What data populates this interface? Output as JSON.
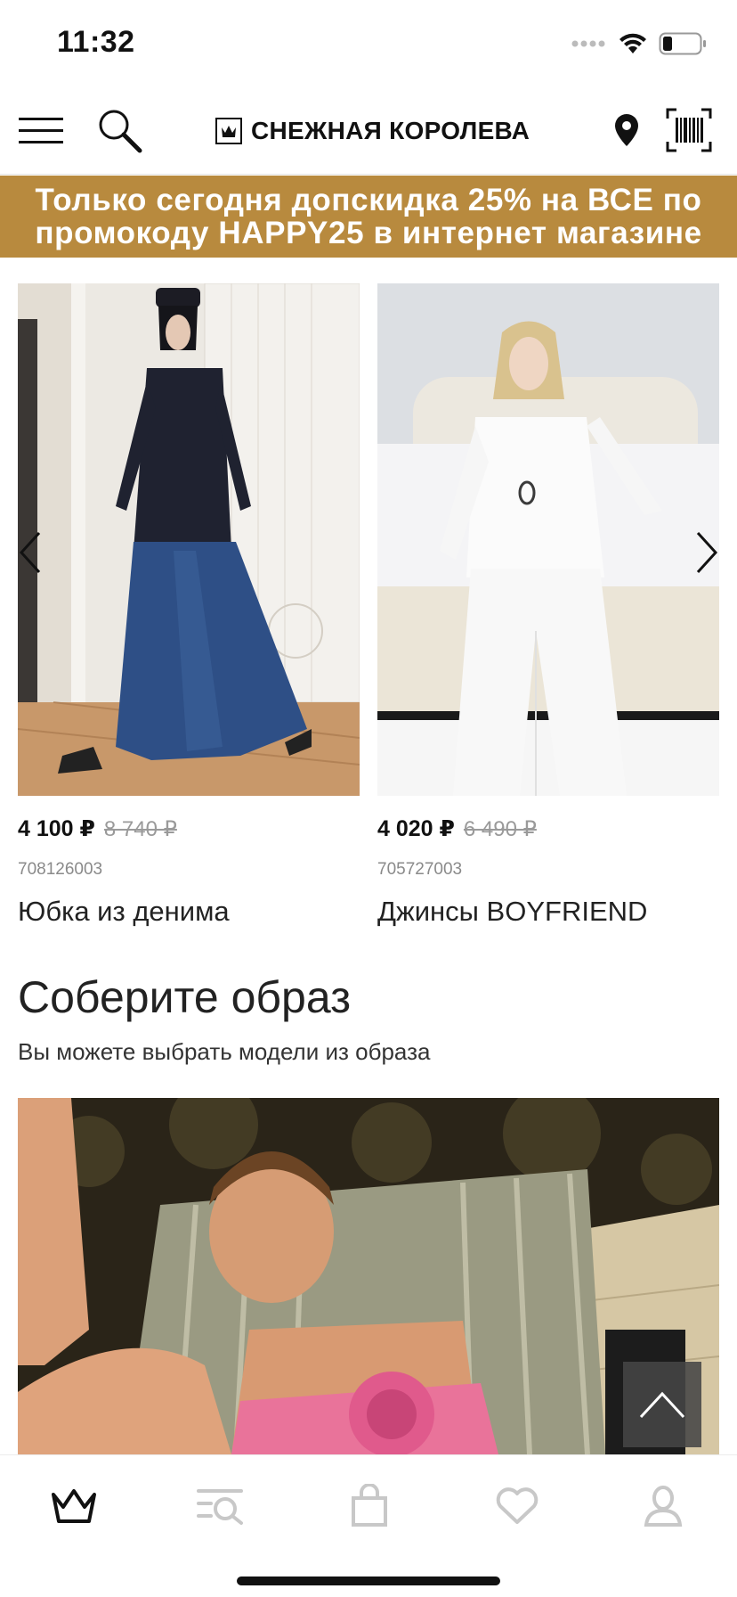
{
  "status": {
    "time": "11:32"
  },
  "header": {
    "brand": "СНЕЖНАЯ КОРОЛЕВА"
  },
  "promo": {
    "line1": "Только сегодня допскидка 25% на ВСЕ по",
    "line2": "промокоду HAPPY25 в интернет магазине"
  },
  "products": [
    {
      "price": "4 100 ₽",
      "old_price": "8 740 ₽",
      "sku": "708126003",
      "name": "Юбка из денима"
    },
    {
      "price": "4 020 ₽",
      "old_price": "6 490 ₽",
      "sku": "705727003",
      "name": "Джинсы BOYFRIEND"
    }
  ],
  "look_section": {
    "title": "Соберите образ",
    "subtitle": "Вы можете выбрать модели из образа"
  },
  "icons": {
    "menu": "menu-icon",
    "search": "search-icon",
    "location": "location-pin-icon",
    "barcode": "barcode-icon",
    "prev": "chevron-left-icon",
    "next": "chevron-right-icon",
    "scroll_top": "chevron-up-icon",
    "tab_home": "crown-icon",
    "tab_catalog": "catalog-search-icon",
    "tab_cart": "shopping-bag-icon",
    "tab_favorites": "heart-icon",
    "tab_profile": "user-icon"
  },
  "colors": {
    "promo_bg": "#b88a3e",
    "text": "#111111",
    "muted": "#8a8a8a"
  }
}
